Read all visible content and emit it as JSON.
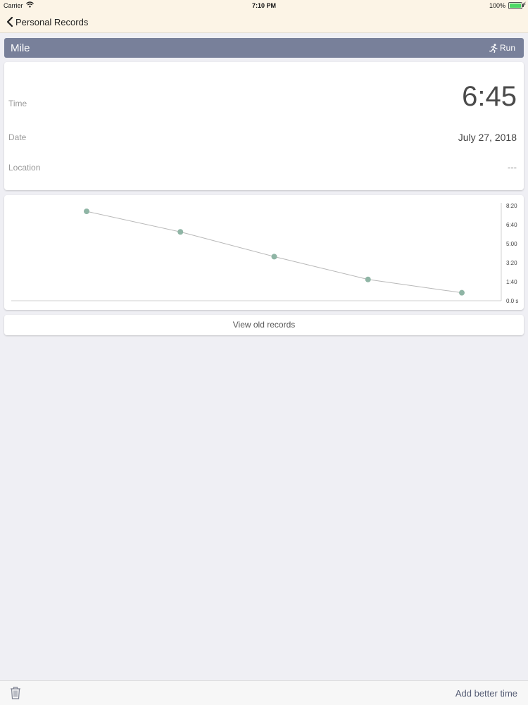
{
  "status_bar": {
    "carrier": "Carrier",
    "time": "7:10 PM",
    "battery": "100%"
  },
  "nav": {
    "back_label": "Personal Records"
  },
  "record": {
    "title": "Mile",
    "activity": "Run",
    "rows": [
      {
        "label": "Time",
        "value": "6:45"
      },
      {
        "label": "Date",
        "value": "July 27, 2018"
      },
      {
        "label": "Location",
        "value": "---"
      }
    ]
  },
  "chart_data": {
    "type": "line",
    "title": "",
    "xlabel": "",
    "ylabel": "",
    "y_tick_labels": [
      "8:20",
      "6:40",
      "5:00",
      "3:20",
      "1:40",
      "0.0 s"
    ],
    "y_ticks_seconds": [
      500,
      400,
      300,
      200,
      100,
      0
    ],
    "ylim": [
      0,
      500
    ],
    "x": [
      1,
      2,
      3,
      4,
      5
    ],
    "values": [
      470,
      362,
      232,
      112,
      42
    ],
    "grid": false,
    "colors": {
      "points": "#8fb5a5",
      "line": "#b8b8b8"
    }
  },
  "buttons": {
    "view_old_records": "View old records",
    "add_better_time": "Add better time"
  },
  "icons": {
    "back": "chevron-left-icon",
    "run": "runner-icon",
    "trash": "trash-icon",
    "wifi": "wifi-icon",
    "battery": "battery-icon"
  }
}
